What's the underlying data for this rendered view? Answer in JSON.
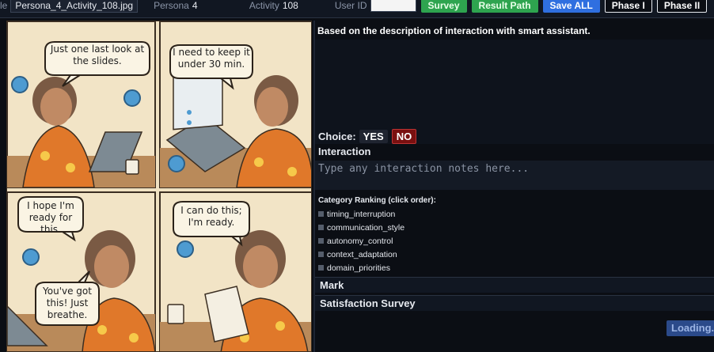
{
  "topbar": {
    "file_label": "le",
    "file_value": "Persona_4_Activity_108.jpg",
    "persona_label": "Persona",
    "persona_value": "4",
    "activity_label": "Activity",
    "activity_value": "108",
    "user_label": "User ID",
    "buttons": [
      "Survey",
      "Result Path",
      "Save ALL",
      "Phase I",
      "Phase II"
    ]
  },
  "comic": {
    "panels": [
      {
        "bubbles": [
          "Just one last look at the slides."
        ]
      },
      {
        "bubbles": [
          "I need to keep it under 30 min."
        ]
      },
      {
        "bubbles": [
          "I hope I'm ready for this.",
          "You've got this! Just breathe."
        ]
      },
      {
        "bubbles": [
          "I can do this; I'm ready."
        ]
      }
    ]
  },
  "right": {
    "description_title": "Based on the description of interaction with smart assistant.",
    "choice_label": "Choice:",
    "yes_label": "YES",
    "no_label": "NO",
    "interaction_label": "Interaction",
    "notes_placeholder": "Type any interaction notes here...",
    "category_title": "Category Ranking (click order):",
    "categories": [
      "timing_interruption",
      "communication_style",
      "autonomy_control",
      "context_adaptation",
      "domain_priorities"
    ],
    "mark_label": "Mark",
    "survey_label": "Satisfaction Survey",
    "loading_label": "Loading..."
  },
  "colors": {
    "background": "#0b0e14",
    "comic_paper": "#f0e2c2",
    "shirt_orange": "#e0782a",
    "no_button": "#7a1010",
    "green_button": "#2ea44f",
    "blue_button": "#2f6fe0"
  }
}
